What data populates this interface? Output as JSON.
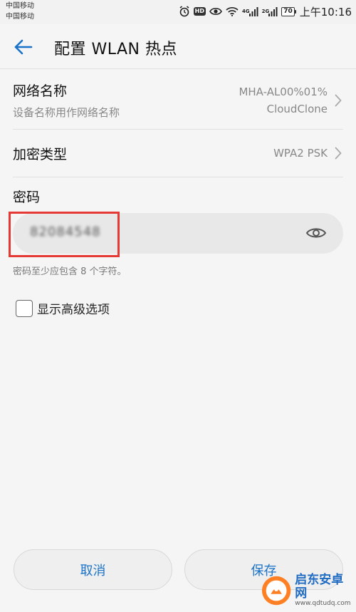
{
  "status_bar": {
    "carrier_1": "中国移动",
    "carrier_2": "中国移动",
    "hd_label": "HD",
    "net_1": "4G",
    "net_2": "2G",
    "battery": "70",
    "time": "上午10:16",
    "icons": [
      "alarm-icon",
      "hd-icon",
      "eye-comfort-icon",
      "wifi-icon",
      "signal-icon",
      "signal-icon",
      "battery-icon"
    ]
  },
  "toolbar": {
    "back_icon": "arrow-left-icon",
    "title": "配置 WLAN 热点"
  },
  "network_name": {
    "label": "网络名称",
    "sublabel": "设备名称用作网络名称",
    "value_line1": "MHA-AL00%01%",
    "value_line2": "CloudClone"
  },
  "security": {
    "label": "加密类型",
    "value": "WPA2 PSK"
  },
  "password": {
    "label": "密码",
    "value": "82084548",
    "hint": "密码至少应包含 8 个字符。"
  },
  "advanced": {
    "label": "显示高级选项",
    "checked": false
  },
  "buttons": {
    "cancel": "取消",
    "save": "保存"
  },
  "watermark": {
    "title": "启东安卓网",
    "url": "www.qdtudq.com"
  },
  "colors": {
    "accent": "#1a73c8",
    "highlight": "#e53935",
    "background": "#f5f5f5"
  }
}
